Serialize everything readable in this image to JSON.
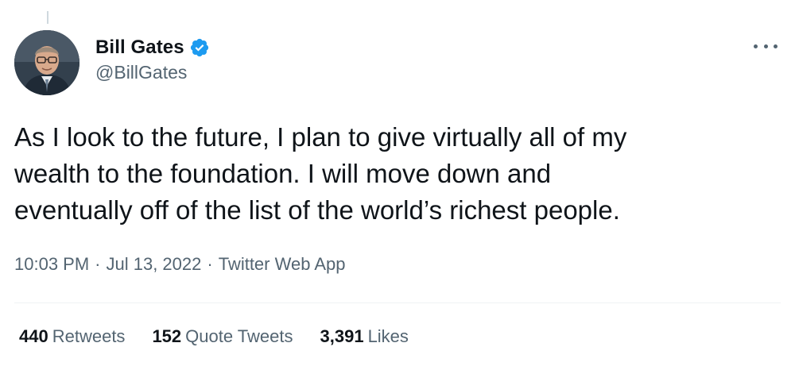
{
  "author": {
    "display_name": "Bill Gates",
    "handle": "@BillGates",
    "verified": true
  },
  "tweet": {
    "lines": [
      "As I look to the future, I plan to give virtually all of my",
      "wealth to the foundation. I will move down and",
      "eventually off of the list of the world’s richest people."
    ]
  },
  "meta": {
    "time": "10:03 PM",
    "separator": "·",
    "date": "Jul 13, 2022",
    "source": "Twitter Web App"
  },
  "stats": {
    "retweets": {
      "count": "440",
      "label": "Retweets"
    },
    "quote_tweets": {
      "count": "152",
      "label": "Quote Tweets"
    },
    "likes": {
      "count": "3,391",
      "label": "Likes"
    }
  },
  "icons": {
    "verified": "verified-badge-icon",
    "more": "more-options-icon"
  },
  "colors": {
    "text_primary": "#0f1419",
    "text_secondary": "#536471",
    "verified_blue": "#1d9bf0",
    "divider": "#eff3f4"
  }
}
